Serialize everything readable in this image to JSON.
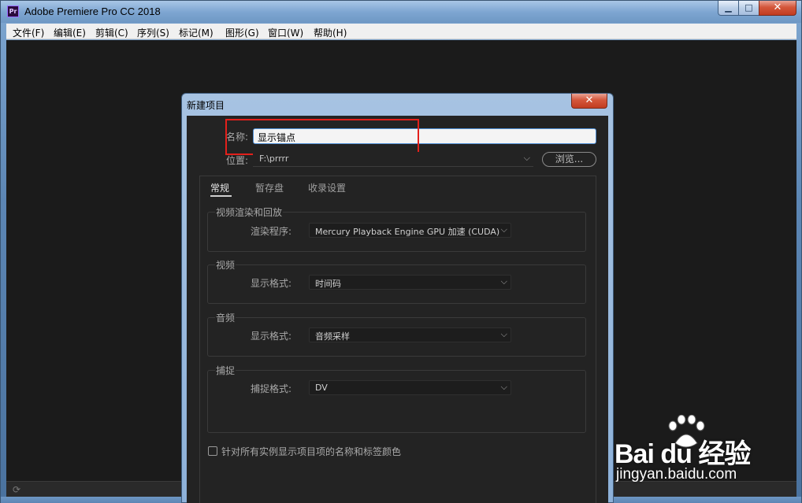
{
  "window": {
    "title": "Adobe Premiere Pro CC 2018",
    "logo_text": "Pr",
    "minimize_glyph": "▁",
    "maximize_glyph": "□",
    "close_glyph": "✕"
  },
  "menubar": {
    "items": [
      {
        "label": "文件(F)"
      },
      {
        "label": "编辑(E)"
      },
      {
        "label": "剪辑(C)"
      },
      {
        "label": "序列(S)"
      },
      {
        "label": "标记(M)"
      },
      {
        "label": "图形(G)"
      },
      {
        "label": "窗口(W)"
      },
      {
        "label": "帮助(H)"
      }
    ]
  },
  "dialog": {
    "title": "新建项目",
    "close_glyph": "✕",
    "name_label": "名称:",
    "name_value": "显示锚点",
    "location_label": "位置:",
    "location_value": "F:\\prrrr",
    "browse_label": "浏览...",
    "tabs": [
      {
        "label": "常规",
        "active": true
      },
      {
        "label": "暂存盘",
        "active": false
      },
      {
        "label": "收录设置",
        "active": false
      }
    ],
    "groups": {
      "render": {
        "title": "视频渲染和回放",
        "field_label": "渲染程序:",
        "value": "Mercury Playback Engine GPU 加速 (CUDA)"
      },
      "video": {
        "title": "视频",
        "field_label": "显示格式:",
        "value": "时间码"
      },
      "audio": {
        "title": "音频",
        "field_label": "显示格式:",
        "value": "音频采样"
      },
      "capture": {
        "title": "捕捉",
        "field_label": "捕捉格式:",
        "value": "DV"
      }
    },
    "checkbox_label": "针对所有实例显示项目项的名称和标签颜色",
    "checkbox_checked": false
  },
  "watermark": {
    "logo_text": "Bai du 经验",
    "url": "jingyan.baidu.com"
  },
  "colors": {
    "highlight": "#e3201b",
    "input_focus": "#4f8fd6",
    "workspace_bg": "#1b1b1b",
    "dialog_bg": "#232323"
  }
}
